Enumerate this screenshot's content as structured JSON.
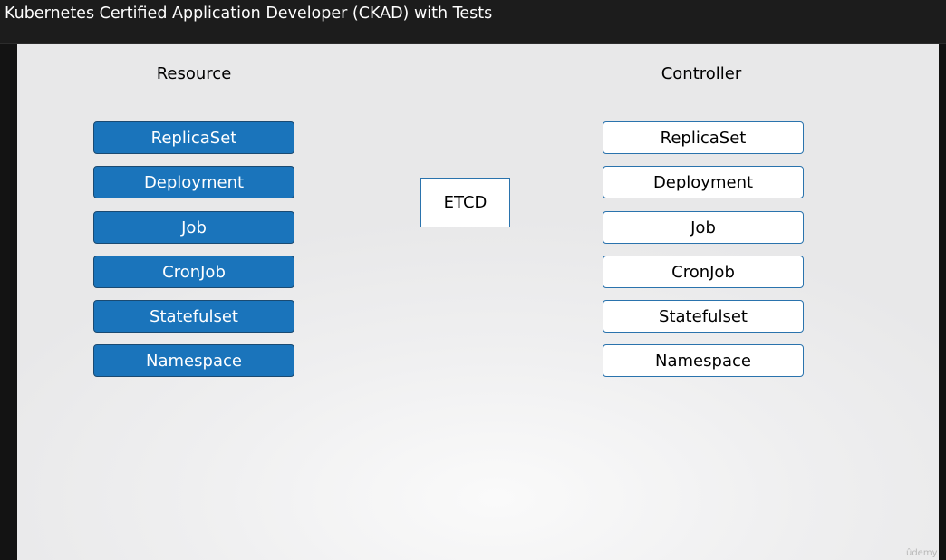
{
  "window": {
    "title": "Kubernetes Certified Application Developer (CKAD) with Tests"
  },
  "slide": {
    "resource_heading": "Resource",
    "controller_heading": "Controller",
    "resources": [
      "ReplicaSet",
      "Deployment",
      "Job",
      "CronJob",
      "Statefulset",
      "Namespace"
    ],
    "controllers": [
      "ReplicaSet",
      "Deployment",
      "Job",
      "CronJob",
      "Statefulset",
      "Namespace"
    ],
    "center_label": "ETCD"
  },
  "watermark": "ûdemy",
  "colors": {
    "resource_fill": "#1a74bb",
    "controller_border": "#2a73ad",
    "title_bar": "#1c1c1c"
  }
}
